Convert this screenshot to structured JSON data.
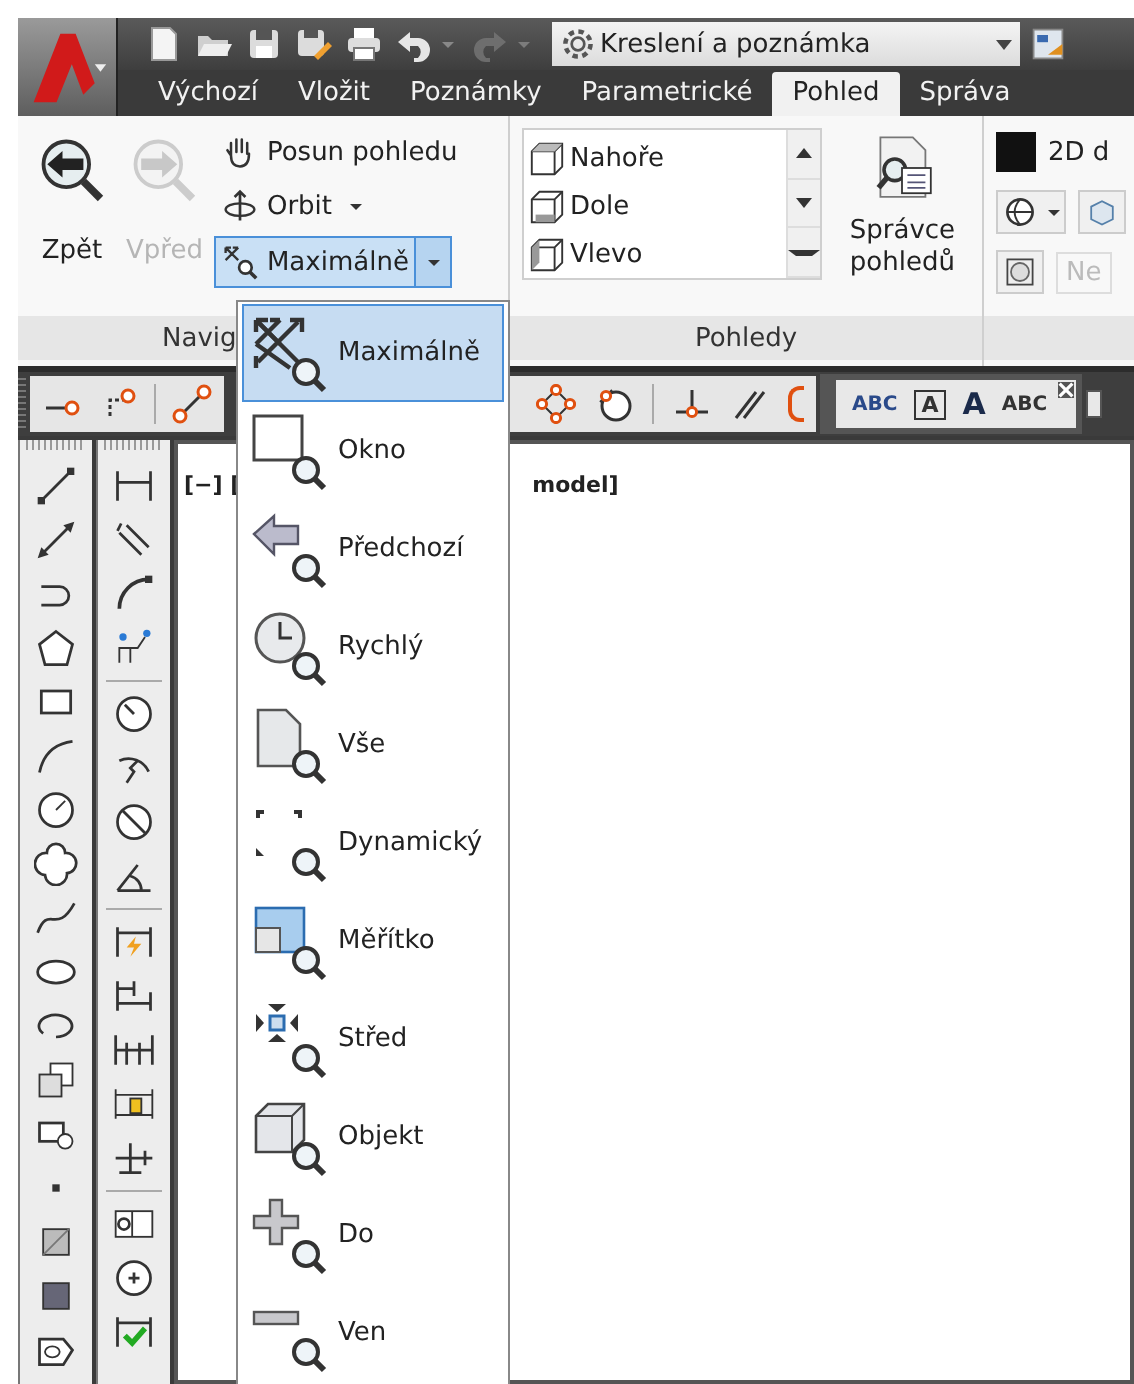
{
  "quick_access": [
    {
      "disabled": false
    },
    {
      "disabled": false
    },
    {
      "disabled": false
    },
    {
      "disabled": false
    },
    {
      "disabled": false
    },
    {
      "disabled": false
    },
    {
      "disabled": true
    }
  ],
  "workspace": "Kreslení a poznámka",
  "tabs": [
    {
      "label": "Výchozí",
      "selected": false
    },
    {
      "label": "Vložit",
      "selected": false
    },
    {
      "label": "Poznámky",
      "selected": false
    },
    {
      "label": "Parametrické",
      "selected": false
    },
    {
      "label": "Pohled",
      "selected": true
    },
    {
      "label": "Správa",
      "selected": false
    }
  ],
  "ribbon": {
    "navigate": {
      "title": "Navig",
      "back": {
        "label": "Zpět",
        "disabled": false
      },
      "forward": {
        "label": "Vpřed",
        "disabled": true
      },
      "pan": "Posun pohledu",
      "orbit": "Orbit",
      "zoom": {
        "label": "Maximálně",
        "pressed": true
      }
    },
    "views": {
      "title": "Pohledy",
      "items": [
        "Nahoře",
        "Dole",
        "Vlevo"
      ],
      "manager": "Správce pohledů"
    },
    "visual": {
      "style": "2D d",
      "field": "Ne"
    }
  },
  "text_toolbar": [
    "ABC",
    "A",
    "A",
    "ABC"
  ],
  "viewport_label": [
    "[−] [",
    "model]"
  ],
  "zoom_menu": [
    {
      "label": "Maximálně",
      "selected": true
    },
    {
      "label": "Okno",
      "selected": false
    },
    {
      "label": "Předchozí",
      "selected": false
    },
    {
      "label": "Rychlý",
      "selected": false
    },
    {
      "label": "Vše",
      "selected": false
    },
    {
      "label": "Dynamický",
      "selected": false
    },
    {
      "label": "Měřítko",
      "selected": false
    },
    {
      "label": "Střed",
      "selected": false
    },
    {
      "label": "Objekt",
      "selected": false
    },
    {
      "label": "Do",
      "selected": false
    },
    {
      "label": "Ven",
      "selected": false
    }
  ]
}
